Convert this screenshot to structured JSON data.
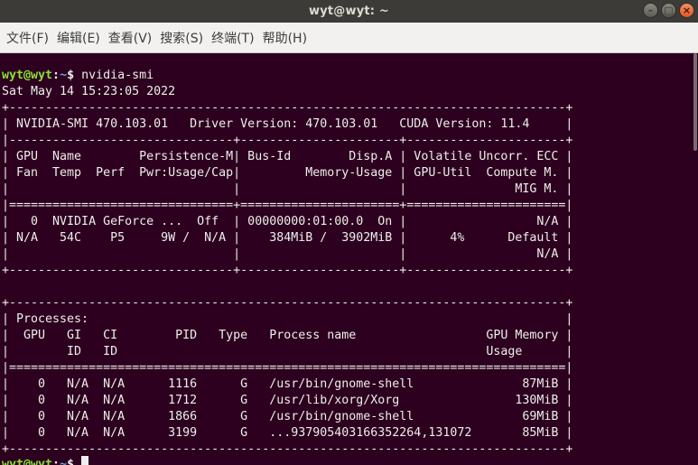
{
  "window": {
    "title": "wyt@wyt: ~",
    "buttons": [
      "–",
      "□",
      "×"
    ]
  },
  "menu": [
    "文件(F)",
    "编辑(E)",
    "查看(V)",
    "搜索(S)",
    "终端(T)",
    "帮助(H)"
  ],
  "prompt": {
    "user_host": "wyt@wyt",
    "colon": ":",
    "path": "~",
    "dollar": "$",
    "command": " nvidia-smi"
  },
  "output": {
    "date_line": "Sat May 14 15:23:05 2022",
    "lines": [
      "+-----------------------------------------------------------------------------+",
      "| NVIDIA-SMI 470.103.01   Driver Version: 470.103.01   CUDA Version: 11.4     |",
      "|-------------------------------+----------------------+----------------------+",
      "| GPU  Name        Persistence-M| Bus-Id        Disp.A | Volatile Uncorr. ECC |",
      "| Fan  Temp  Perf  Pwr:Usage/Cap|         Memory-Usage | GPU-Util  Compute M. |",
      "|                               |                      |               MIG M. |",
      "|===============================+======================+======================|",
      "|   0  NVIDIA GeForce ...  Off  | 00000000:01:00.0  On |                  N/A |",
      "| N/A   54C    P5     9W /  N/A |    384MiB /  3902MiB |      4%      Default |",
      "|                               |                      |                  N/A |",
      "+-------------------------------+----------------------+----------------------+",
      "",
      "+-----------------------------------------------------------------------------+",
      "| Processes:                                                                  |",
      "|  GPU   GI   CI        PID   Type   Process name                  GPU Memory |",
      "|        ID   ID                                                   Usage      |",
      "|=============================================================================|",
      "|    0   N/A  N/A      1116      G   /usr/bin/gnome-shell               87MiB |",
      "|    0   N/A  N/A      1712      G   /usr/lib/xorg/Xorg                130MiB |",
      "|    0   N/A  N/A      1866      G   /usr/bin/gnome-shell               69MiB |",
      "|    0   N/A  N/A      3199      G   ...937905403166352264,131072       85MiB |",
      "+-----------------------------------------------------------------------------+"
    ]
  }
}
